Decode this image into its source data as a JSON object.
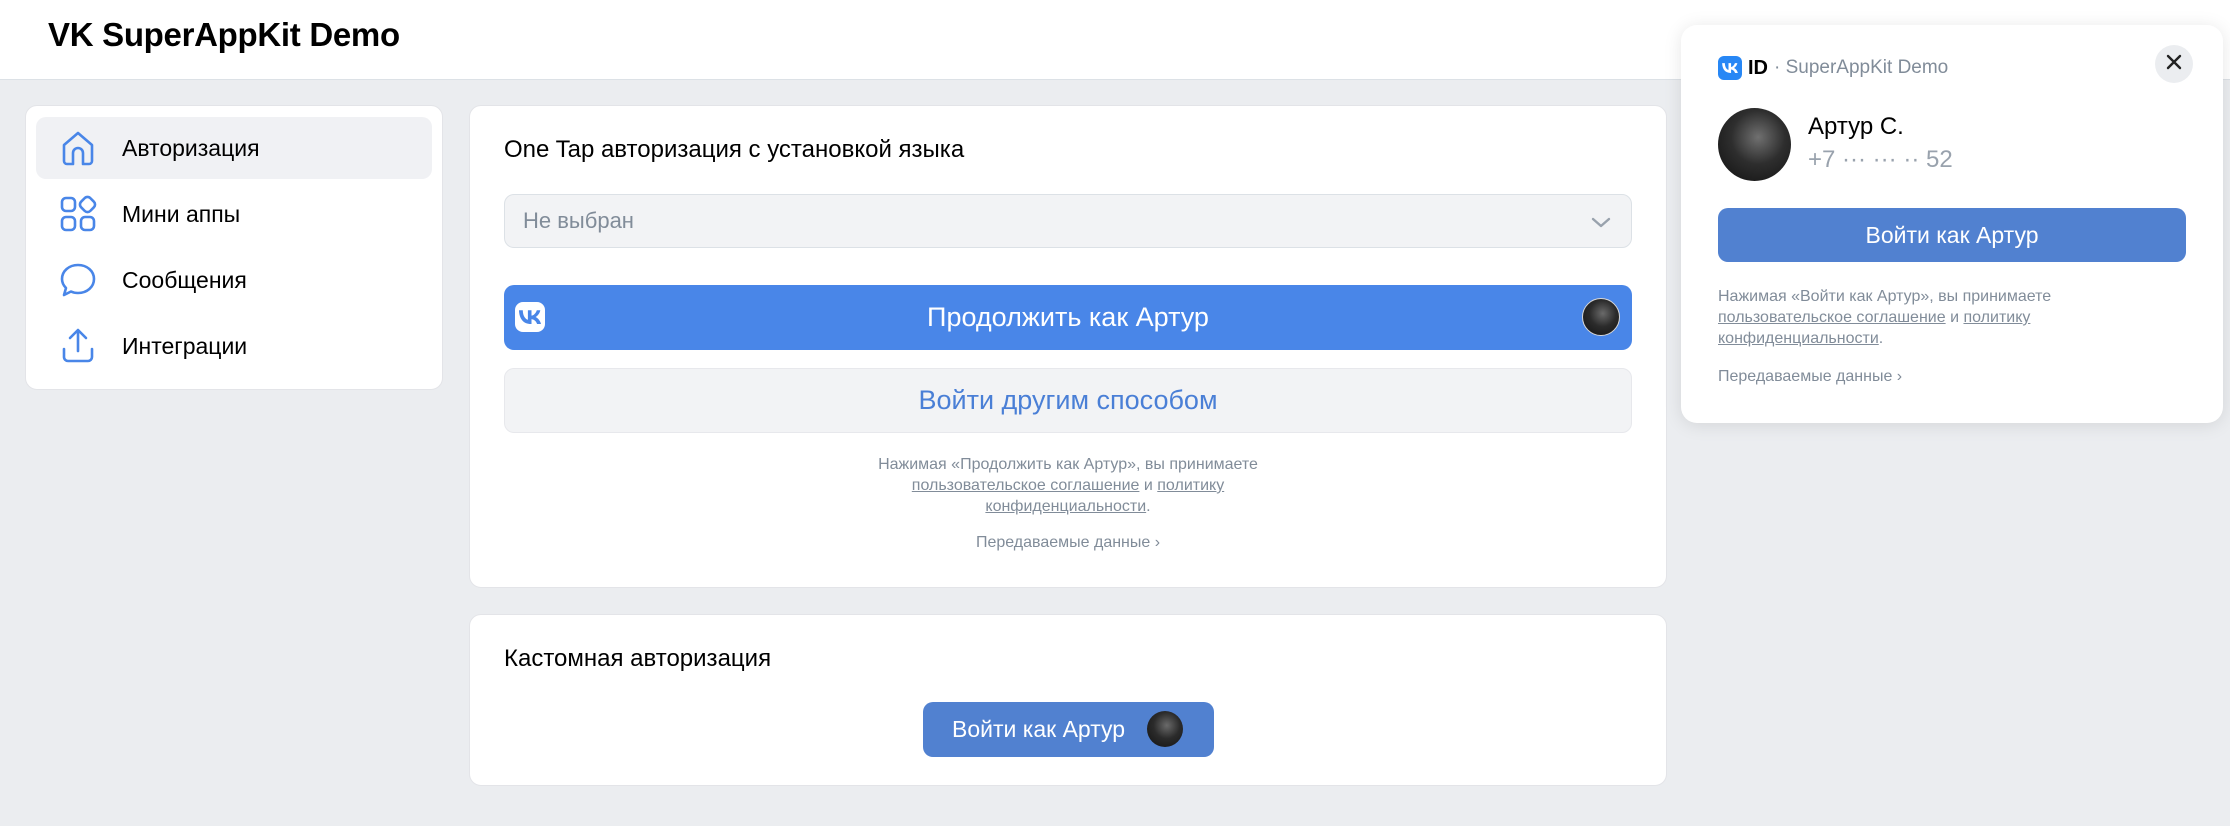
{
  "app": {
    "title": "VK SuperAppKit Demo"
  },
  "sidebar": {
    "items": [
      {
        "label": "Авторизация",
        "icon": "home-icon",
        "active": true
      },
      {
        "label": "Мини аппы",
        "icon": "apps-icon",
        "active": false
      },
      {
        "label": "Сообщения",
        "icon": "message-icon",
        "active": false
      },
      {
        "label": "Интеграции",
        "icon": "share-icon",
        "active": false
      }
    ]
  },
  "onetap": {
    "title": "One Tap авторизация с установкой языка",
    "select": {
      "value": "Не выбран"
    },
    "continue_label": "Продолжить как Артур",
    "other_label": "Войти другим способом",
    "terms": {
      "prefix": "Нажимая «Продолжить как Артур», вы принимаете",
      "agreement": "пользовательское соглашение",
      "and": "и",
      "policy_a": "политику",
      "policy_b": "конфиденциальности",
      "end": "."
    },
    "data_link": "Передаваемые данные ›"
  },
  "custom": {
    "title": "Кастомная авторизация",
    "button_label": "Войти как Артур"
  },
  "popup": {
    "brand": "ID",
    "app_name": "· SuperAppKit Demo",
    "user_name": "Артур С.",
    "user_phone": "+7 ··· ··· ·· 52",
    "button_label": "Войти как Артур",
    "terms": {
      "prefix": "Нажимая «Войти как Артур», вы принимаете",
      "agreement": "пользовательское соглашение",
      "and": "и",
      "policy_a": "политику",
      "policy_b": "конфиденциальности",
      "end": "."
    },
    "data_link": "Передаваемые данные ›"
  },
  "colors": {
    "accent": "#4986e8",
    "button": "#5181d0",
    "link": "#4a7fd6",
    "muted": "#818c99",
    "background": "#ebedf0"
  }
}
